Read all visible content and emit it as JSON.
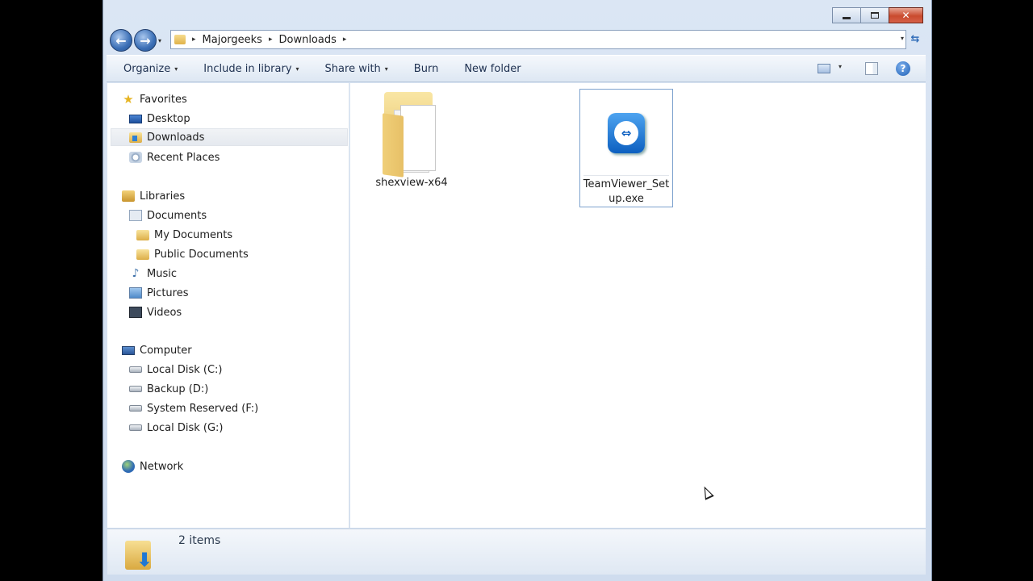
{
  "titlebar": {
    "controls": [
      "minimize-icon",
      "maximize-icon",
      "close-icon"
    ],
    "close_glyph": "✕"
  },
  "nav": {
    "back_glyph": "←",
    "forward_glyph": "→",
    "history_caret": "▾"
  },
  "address": {
    "crumbs": [
      "Majorgeeks",
      "Downloads"
    ],
    "separator": "▸",
    "dropdown": "▾"
  },
  "refresh_glyph": "⇆",
  "toolbar": {
    "organize": "Organize",
    "include_in_library": "Include in library",
    "share_with": "Share with",
    "burn": "Burn",
    "new_folder": "New folder",
    "caret": "▾",
    "help": "?"
  },
  "sidebar": {
    "favorites": {
      "label": "Favorites",
      "items": [
        "Desktop",
        "Downloads",
        "Recent Places"
      ]
    },
    "libraries": {
      "label": "Libraries",
      "items": [
        "Documents",
        "My Documents",
        "Public Documents",
        "Music",
        "Pictures",
        "Videos"
      ]
    },
    "computer": {
      "label": "Computer",
      "items": [
        "Local Disk (C:)",
        "Backup (D:)",
        "System Reserved (F:)",
        "Local Disk (G:)"
      ]
    },
    "network": {
      "label": "Network"
    },
    "selected": "Downloads"
  },
  "files": [
    {
      "name": "shexview-x64",
      "type": "folder",
      "icon": "folder-icon"
    },
    {
      "name": "TeamViewer_Setup.exe",
      "type": "application",
      "icon": "teamviewer-icon",
      "selected": true
    }
  ],
  "details": {
    "count": "2 items"
  },
  "colors": {
    "accent": "#3b6fb6",
    "selection_border": "#7da2ce",
    "window_frame": "#cfdcee",
    "close_red": "#c94a2e"
  }
}
